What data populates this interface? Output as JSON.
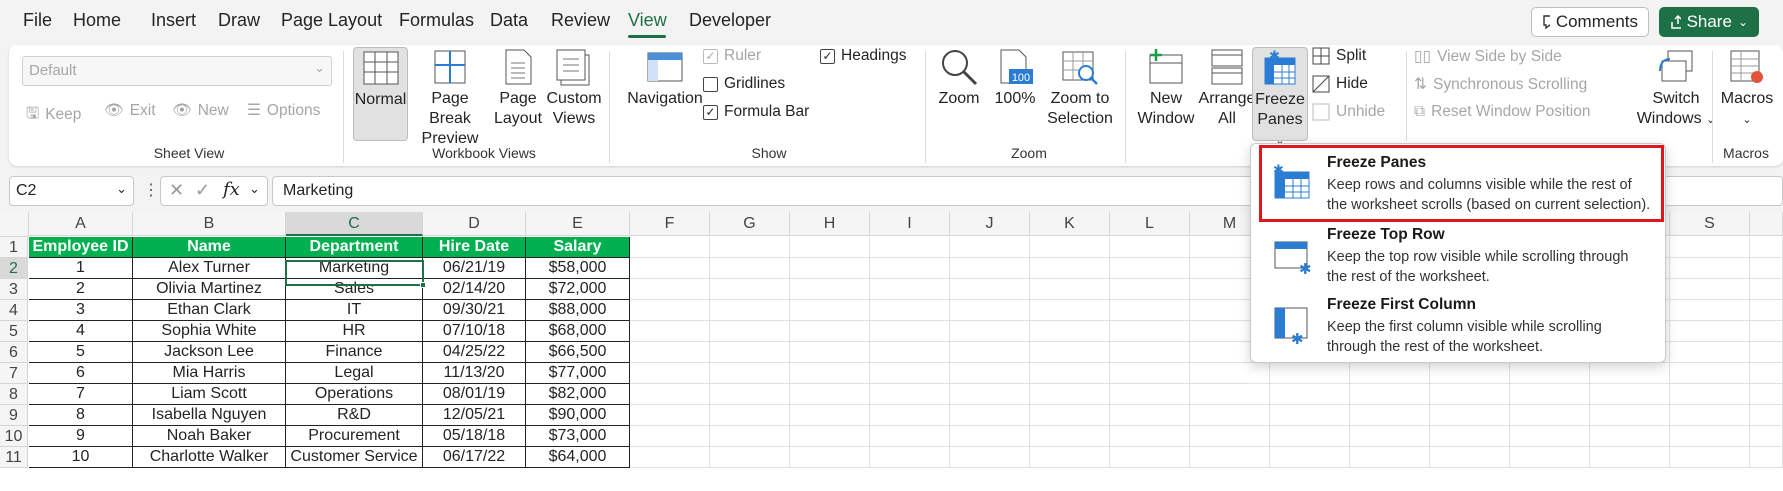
{
  "menubar": {
    "tabs": [
      "File",
      "Home",
      "Insert",
      "Draw",
      "Page Layout",
      "Formulas",
      "Data",
      "Review",
      "View",
      "Developer"
    ],
    "active_tab": "View",
    "comments_label": "Comments",
    "share_label": "Share"
  },
  "ribbon": {
    "sheet_view": {
      "dropdown_value": "Default",
      "keep": "Keep",
      "exit": "Exit",
      "new": "New",
      "options": "Options",
      "label": "Sheet View"
    },
    "workbook_views": {
      "normal": "Normal",
      "page_break_1": "Page Break",
      "page_break_2": "Preview",
      "page_layout_1": "Page",
      "page_layout_2": "Layout",
      "custom_views_1": "Custom",
      "custom_views_2": "Views",
      "label": "Workbook Views"
    },
    "show": {
      "navigation": "Navigation",
      "ruler": "Ruler",
      "gridlines": "Gridlines",
      "formula_bar": "Formula Bar",
      "headings": "Headings",
      "label": "Show"
    },
    "zoom": {
      "zoom": "Zoom",
      "hundred": "100%",
      "zoom_sel_1": "Zoom to",
      "zoom_sel_2": "Selection",
      "hundred_icon_text": "100",
      "label": "Zoom"
    },
    "window": {
      "new_window_1": "New",
      "new_window_2": "Window",
      "arrange_1": "Arrange",
      "arrange_2": "All",
      "freeze_1": "Freeze",
      "freeze_2": "Panes",
      "split": "Split",
      "hide": "Hide",
      "unhide": "Unhide",
      "view_side": "View Side by Side",
      "sync_scroll": "Synchronous Scrolling",
      "reset_pos": "Reset Window Position",
      "switch_1": "Switch",
      "switch_2": "Windows"
    },
    "macros": {
      "macros": "Macros",
      "label": "Macros"
    }
  },
  "formula_bar": {
    "name_box": "C2",
    "formula": "Marketing"
  },
  "sheet": {
    "columns": [
      "A",
      "B",
      "C",
      "D",
      "E",
      "F",
      "G",
      "H",
      "I",
      "J",
      "K",
      "L",
      "M",
      "S"
    ],
    "selected_column": "C",
    "rows": [
      "1",
      "2",
      "3",
      "4",
      "5",
      "6",
      "7",
      "8",
      "9",
      "10",
      "11"
    ],
    "selected_row": "2",
    "headers": [
      "Employee ID",
      "Name",
      "Department",
      "Hire Date",
      "Salary"
    ],
    "data": [
      [
        "1",
        "Alex Turner",
        "Marketing",
        "06/21/19",
        "$58,000"
      ],
      [
        "2",
        "Olivia Martinez",
        "Sales",
        "02/14/20",
        "$72,000"
      ],
      [
        "3",
        "Ethan Clark",
        "IT",
        "09/30/21",
        "$88,000"
      ],
      [
        "4",
        "Sophia White",
        "HR",
        "07/10/18",
        "$68,000"
      ],
      [
        "5",
        "Jackson Lee",
        "Finance",
        "04/25/22",
        "$66,500"
      ],
      [
        "6",
        "Mia Harris",
        "Legal",
        "11/13/20",
        "$77,000"
      ],
      [
        "7",
        "Liam Scott",
        "Operations",
        "08/01/19",
        "$82,000"
      ],
      [
        "8",
        "Isabella Nguyen",
        "R&D",
        "12/05/21",
        "$90,000"
      ],
      [
        "9",
        "Noah Baker",
        "Procurement",
        "05/18/18",
        "$73,000"
      ],
      [
        "10",
        "Charlotte Walker",
        "Customer Service",
        "06/17/22",
        "$64,000"
      ]
    ]
  },
  "freeze_menu": {
    "items": [
      {
        "title": "Freeze Panes",
        "desc": "Keep rows and columns visible while the rest of the worksheet scrolls (based on current selection)."
      },
      {
        "title": "Freeze Top Row",
        "desc": "Keep the top row visible while scrolling through the rest of the worksheet."
      },
      {
        "title": "Freeze First Column",
        "desc": "Keep the first column visible while scrolling through the rest of the worksheet."
      }
    ]
  },
  "colors": {
    "accent": "#1e7145",
    "header_fill": "#00b050",
    "highlight": "#e0161e"
  }
}
